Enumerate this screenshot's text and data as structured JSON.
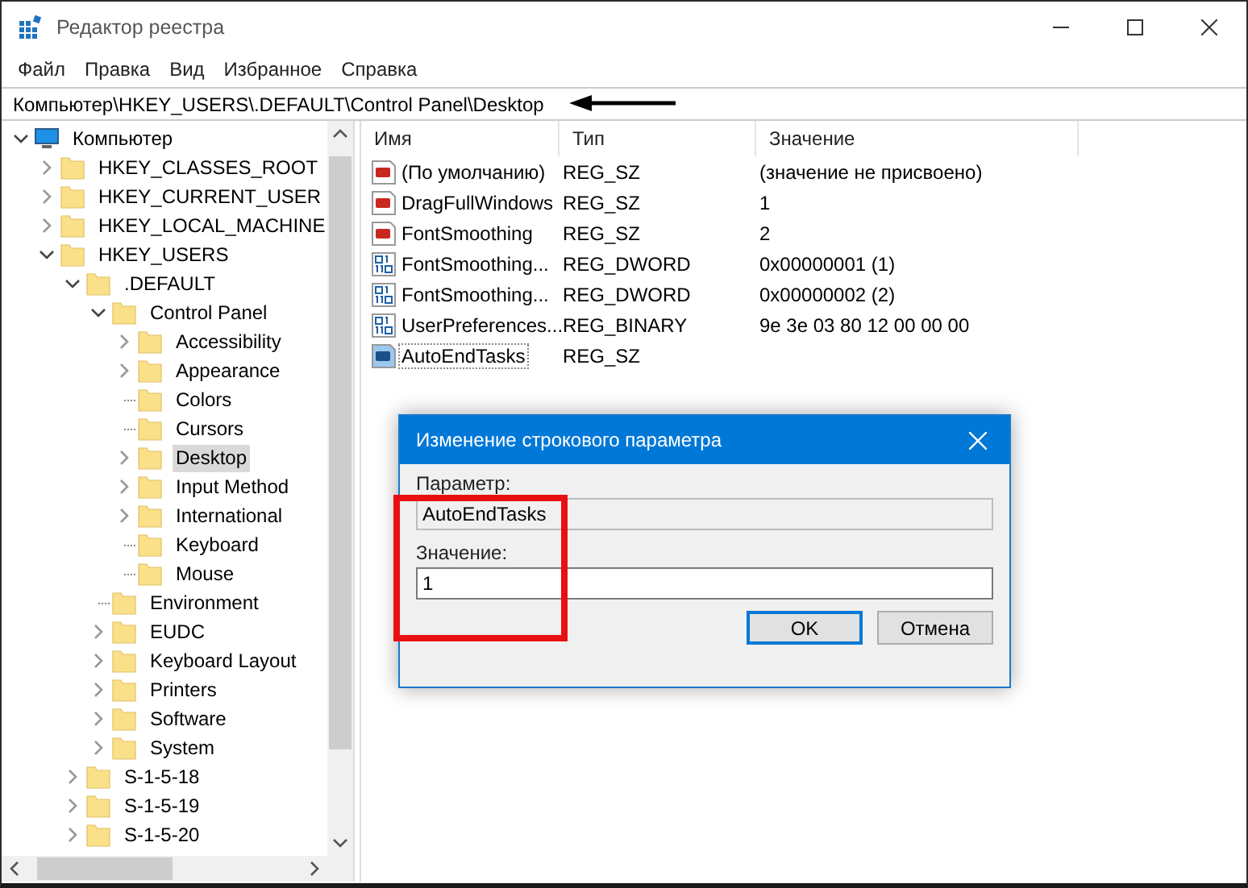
{
  "window": {
    "title": "Редактор реестра"
  },
  "menu": [
    "Файл",
    "Правка",
    "Вид",
    "Избранное",
    "Справка"
  ],
  "address": {
    "value": "Компьютер\\HKEY_USERS\\.DEFAULT\\Control Panel\\Desktop"
  },
  "tree": [
    {
      "label": "Компьютер",
      "kind": "computer",
      "expanded": true,
      "selected": false,
      "children": [
        {
          "label": "HKEY_CLASSES_ROOT",
          "kind": "folder",
          "expanded": false,
          "selected": false
        },
        {
          "label": "HKEY_CURRENT_USER",
          "kind": "folder",
          "expanded": false,
          "selected": false
        },
        {
          "label": "HKEY_LOCAL_MACHINE",
          "kind": "folder",
          "expanded": false,
          "selected": false
        },
        {
          "label": "HKEY_USERS",
          "kind": "folder",
          "expanded": true,
          "selected": false,
          "children": [
            {
              "label": ".DEFAULT",
              "kind": "folder",
              "expanded": true,
              "selected": false,
              "children": [
                {
                  "label": "Control Panel",
                  "kind": "folder",
                  "expanded": true,
                  "selected": false,
                  "children": [
                    {
                      "label": "Accessibility",
                      "kind": "folder",
                      "expanded": false,
                      "selected": false
                    },
                    {
                      "label": "Appearance",
                      "kind": "folder",
                      "expanded": false,
                      "selected": false
                    },
                    {
                      "label": "Colors",
                      "kind": "leaf",
                      "selected": false
                    },
                    {
                      "label": "Cursors",
                      "kind": "leaf",
                      "selected": false
                    },
                    {
                      "label": "Desktop",
                      "kind": "folder",
                      "expanded": false,
                      "selected": true
                    },
                    {
                      "label": "Input Method",
                      "kind": "folder",
                      "expanded": false,
                      "selected": false
                    },
                    {
                      "label": "International",
                      "kind": "folder",
                      "expanded": false,
                      "selected": false
                    },
                    {
                      "label": "Keyboard",
                      "kind": "leaf",
                      "selected": false
                    },
                    {
                      "label": "Mouse",
                      "kind": "leaf",
                      "selected": false
                    }
                  ]
                },
                {
                  "label": "Environment",
                  "kind": "leaf",
                  "selected": false
                },
                {
                  "label": "EUDC",
                  "kind": "folder",
                  "expanded": false,
                  "selected": false
                },
                {
                  "label": "Keyboard Layout",
                  "kind": "folder",
                  "expanded": false,
                  "selected": false
                },
                {
                  "label": "Printers",
                  "kind": "folder",
                  "expanded": false,
                  "selected": false
                },
                {
                  "label": "Software",
                  "kind": "folder",
                  "expanded": false,
                  "selected": false
                },
                {
                  "label": "System",
                  "kind": "folder",
                  "expanded": false,
                  "selected": false
                }
              ]
            },
            {
              "label": "S-1-5-18",
              "kind": "folder",
              "expanded": false,
              "selected": false
            },
            {
              "label": "S-1-5-19",
              "kind": "folder",
              "expanded": false,
              "selected": false
            },
            {
              "label": "S-1-5-20",
              "kind": "folder",
              "expanded": false,
              "selected": false
            }
          ]
        }
      ]
    }
  ],
  "table": {
    "columns": [
      "Имя",
      "Тип",
      "Значение"
    ],
    "rows": [
      {
        "kind": "string",
        "selected": false,
        "cells": [
          "(По умолчанию)",
          "REG_SZ",
          "(значение не присвоено)"
        ]
      },
      {
        "kind": "string",
        "selected": false,
        "cells": [
          "DragFullWindows",
          "REG_SZ",
          "1"
        ]
      },
      {
        "kind": "string",
        "selected": false,
        "cells": [
          "FontSmoothing",
          "REG_SZ",
          "2"
        ]
      },
      {
        "kind": "binary",
        "selected": false,
        "cells": [
          "FontSmoothing...",
          "REG_DWORD",
          "0x00000001 (1)"
        ]
      },
      {
        "kind": "binary",
        "selected": false,
        "cells": [
          "FontSmoothing...",
          "REG_DWORD",
          "0x00000002 (2)"
        ]
      },
      {
        "kind": "binary",
        "selected": false,
        "cells": [
          "UserPreferences...",
          "REG_BINARY",
          "9e 3e 03 80 12 00 00 00"
        ]
      },
      {
        "kind": "string",
        "selected": true,
        "cells": [
          "AutoEndTasks",
          "REG_SZ"
        ]
      }
    ]
  },
  "dialog": {
    "title": "Изменение строкового параметра",
    "name_label": "Параметр:",
    "name_value": "AutoEndTasks",
    "value_label": "Значение:",
    "value": "1",
    "buttons": [
      "OK",
      "Отмена"
    ]
  }
}
